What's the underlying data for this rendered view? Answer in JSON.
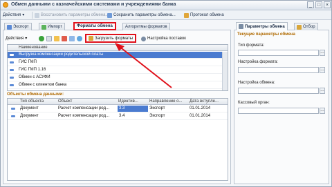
{
  "window": {
    "title": "Обмен данными с казначейскими системами и учреждениями банка"
  },
  "toolbar": {
    "actions": "Действия",
    "restore": "Восстановить параметры обмена...",
    "save": "Сохранить параметры обмена...",
    "protocol": "Протокол обмена"
  },
  "tabs": [
    {
      "label": "Экспорт"
    },
    {
      "label": "Импорт"
    },
    {
      "label": "Форматы обмена"
    },
    {
      "label": "Алгоритмы форматов"
    }
  ],
  "left_toolbar": {
    "actions": "Действия",
    "load": "Загрузить форматы",
    "settings": "Настройка поставок"
  },
  "formats_grid": {
    "header": "Наименование",
    "rows": [
      "Выгрузка компенсации родительской платы",
      "ГИС ГМП",
      "ГИС ГМП 1.16",
      "Обмен с АСУФИ",
      "Обмен с клиентом банка"
    ]
  },
  "objects": {
    "title": "Объекты обмена данными:",
    "columns": [
      "Тип объекта",
      "Объект",
      "Идентив...",
      "Направление о...",
      "Дата вступле..."
    ],
    "rows": [
      [
        "Документ",
        "Расчет компенсации род...",
        "3.3",
        "Экспорт",
        "01.01.2014"
      ],
      [
        "Документ",
        "Расчет компенсации род...",
        "3.4",
        "Экспорт",
        "01.01.2014"
      ]
    ]
  },
  "right": {
    "tabs": [
      {
        "label": "Параметры обмена"
      },
      {
        "label": "Отбор"
      }
    ],
    "section": "Текущие параметры обмена",
    "fields": [
      {
        "label": "Тип формата:"
      },
      {
        "label": "Настройка формата:"
      },
      {
        "label": "Настройка обмена:"
      },
      {
        "label": "Кассовый орган:"
      }
    ]
  },
  "colors": {
    "highlight": "#e0101a",
    "selection": "#4a7bd0",
    "accent": "#b06a00"
  }
}
